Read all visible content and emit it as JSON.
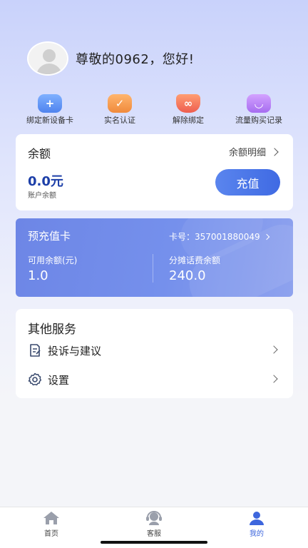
{
  "profile": {
    "greeting": "尊敬的0962，您好!"
  },
  "quick_actions": [
    {
      "label": "绑定新设备卡",
      "icon": "add-device-icon",
      "color": "#5b8ef0"
    },
    {
      "label": "实名认证",
      "icon": "id-verify-icon",
      "color": "#f4944f"
    },
    {
      "label": "解除绑定",
      "icon": "unbind-icon",
      "color": "#f2735d"
    },
    {
      "label": "流量购买记录",
      "icon": "shopping-bag-icon",
      "color": "#b37af3"
    }
  ],
  "balance": {
    "title": "余额",
    "detail_link": "余额明细",
    "value": "0.0元",
    "subtitle": "账户余额",
    "recharge_label": "充值"
  },
  "prepaid": {
    "title": "预充值卡",
    "card_number": "卡号：357001880049",
    "available_label": "可用余额(元)",
    "available_value": "1.0",
    "shared_label": "分摊话费余额",
    "shared_value": "240.0"
  },
  "services": {
    "title": "其他服务",
    "items": [
      {
        "label": "投诉与建议",
        "icon": "feedback-icon"
      },
      {
        "label": "设置",
        "icon": "settings-icon"
      }
    ]
  },
  "tabbar": {
    "items": [
      {
        "label": "首页",
        "icon": "home-icon",
        "active": false
      },
      {
        "label": "客服",
        "icon": "customer-service-icon",
        "active": false
      },
      {
        "label": "我的",
        "icon": "profile-icon",
        "active": true
      }
    ]
  },
  "colors": {
    "accent": "#3f6ae3",
    "prepaid_card": "#7590ec"
  }
}
